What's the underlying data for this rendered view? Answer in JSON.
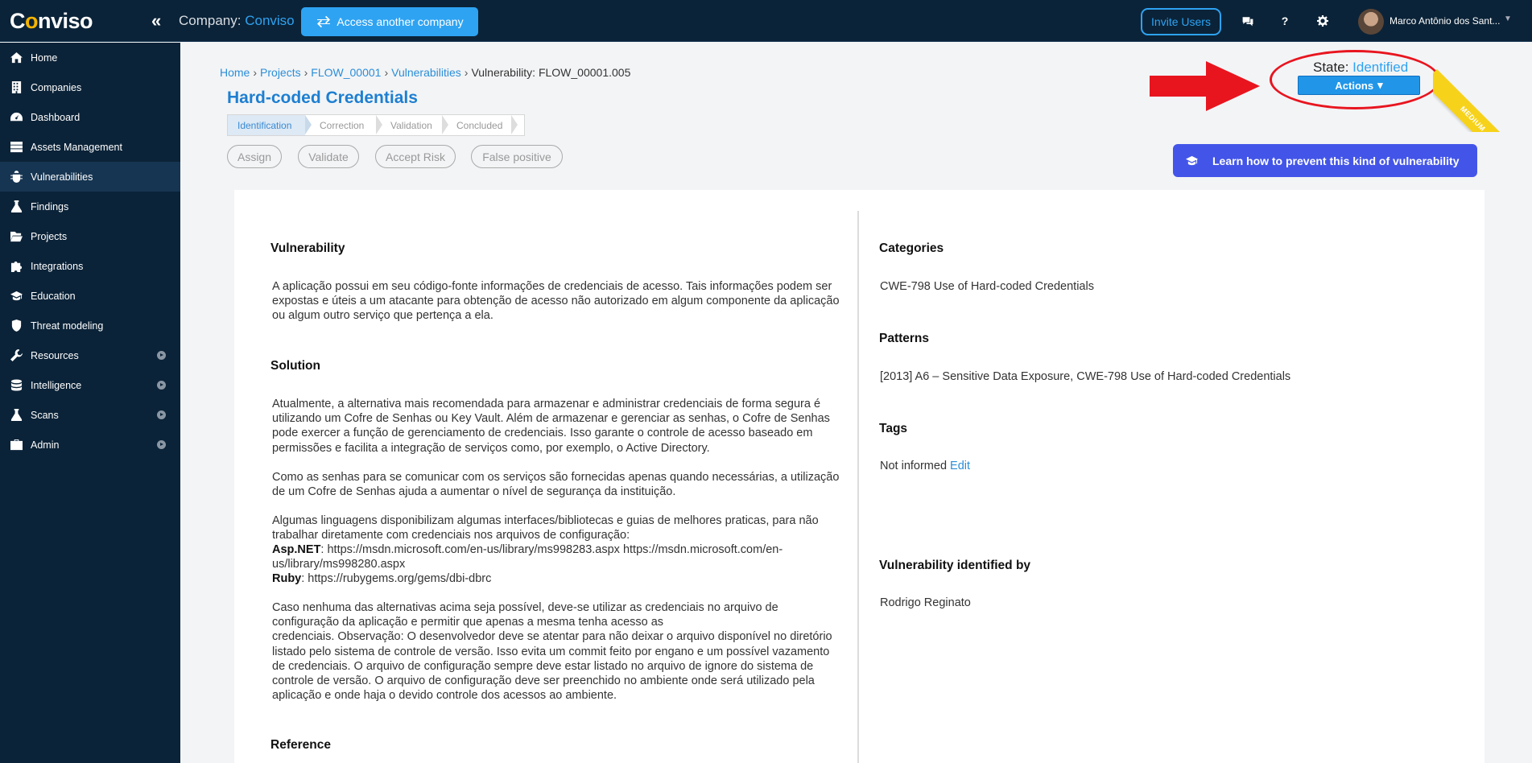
{
  "header": {
    "logo_text_c": "C",
    "logo_text_o": "o",
    "logo_text_rest": "nviso",
    "company_label": "Company:",
    "company_name": "Conviso",
    "access_button": "Access another company",
    "invite_button": "Invite Users",
    "user_name": "Marco Antônio dos Sant..."
  },
  "sidebar": {
    "items": [
      {
        "label": "Home",
        "icon": "home-icon"
      },
      {
        "label": "Companies",
        "icon": "building-icon"
      },
      {
        "label": "Dashboard",
        "icon": "dashboard-icon"
      },
      {
        "label": "Assets Management",
        "icon": "server-icon"
      },
      {
        "label": "Vulnerabilities",
        "icon": "bug-icon",
        "active": true
      },
      {
        "label": "Findings",
        "icon": "flask-icon"
      },
      {
        "label": "Projects",
        "icon": "folder-open-icon"
      },
      {
        "label": "Integrations",
        "icon": "puzzle-icon"
      },
      {
        "label": "Education",
        "icon": "graduation-cap-icon"
      },
      {
        "label": "Threat modeling",
        "icon": "shield-icon"
      },
      {
        "label": "Resources",
        "icon": "wrench-icon",
        "expandable": true
      },
      {
        "label": "Intelligence",
        "icon": "database-icon",
        "expandable": true
      },
      {
        "label": "Scans",
        "icon": "flask-icon",
        "expandable": true
      },
      {
        "label": "Admin",
        "icon": "briefcase-icon",
        "expandable": true
      }
    ]
  },
  "breadcrumb": {
    "home": "Home",
    "projects": "Projects",
    "project": "FLOW_00001",
    "vulnerabilities": "Vulnerabilities",
    "current": "Vulnerability: FLOW_00001.005"
  },
  "page_title": "Hard-coded Credentials",
  "steps": [
    "Identification",
    "Correction",
    "Validation",
    "Concluded"
  ],
  "actions_row": [
    "Assign",
    "Validate",
    "Accept Risk",
    "False positive"
  ],
  "state": {
    "label": "State:",
    "value": "Identified",
    "actions_button": "Actions",
    "severity_ribbon": "MEDIUM"
  },
  "learn_button": "Learn how to prevent this kind of vulnerability",
  "left": {
    "vulnerability_title": "Vulnerability",
    "vulnerability_text": "A aplicação possui em seu código-fonte informações de credenciais de acesso. Tais informações podem ser expostas e úteis a um atacante para obtenção de acesso não autorizado em algum componente da aplicação ou algum outro serviço que pertença a ela.",
    "solution_title": "Solution",
    "solution_p1": "Atualmente, a alternativa mais recomendada para armazenar e administrar credenciais de forma segura é utilizando um Cofre de Senhas ou Key Vault. Além de armazenar e gerenciar as senhas, o Cofre de Senhas pode exercer a função de gerenciamento de credenciais. Isso garante o controle de acesso baseado em permissões e facilita a integração de serviços como, por exemplo, o Active Directory.",
    "solution_p2": "Como as senhas para se comunicar com os serviços são fornecidas apenas quando necessárias, a utilização de um Cofre de Senhas ajuda a aumentar o nível de segurança da instituição.",
    "solution_p3": "Algumas linguagens disponibilizam algumas interfaces/bibliotecas e guias de melhores praticas, para não trabalhar diretamente com credenciais nos arquivos de configuração:",
    "aspnet_label": "Asp.NET",
    "aspnet_links": ": https://msdn.microsoft.com/en-us/library/ms998283.aspx https://msdn.microsoft.com/en-us/library/ms998280.aspx",
    "ruby_label": "Ruby",
    "ruby_links": ": https://rubygems.org/gems/dbi-dbrc",
    "solution_p4a": "Caso nenhuma das alternativas acima seja possível, deve-se utilizar as credenciais no arquivo de configuração da aplicação e permitir que apenas a mesma tenha acesso as",
    "solution_p4b": "credenciais. Observação: O desenvolvedor deve se atentar para não deixar o arquivo disponível no diretório listado pelo sistema de controle de versão. Isso evita um commit feito por engano e um possível vazamento de credenciais. O arquivo de configuração sempre deve estar listado no arquivo de ignore do sistema de controle de versão. O arquivo de configuração deve ser preenchido no ambiente onde será utilizado pela aplicação e onde haja o devido controle dos acessos ao ambiente.",
    "reference_title": "Reference"
  },
  "right": {
    "categories_title": "Categories",
    "categories_value": "CWE-798 Use of Hard-coded Credentials",
    "patterns_title": "Patterns",
    "patterns_value": "[2013] A6 – Sensitive Data Exposure, CWE-798 Use of Hard-coded Credentials",
    "tags_title": "Tags",
    "tags_value": "Not informed",
    "tags_edit": "Edit",
    "identified_by_title": "Vulnerability identified by",
    "identified_by_value": "Rodrigo Reginato"
  },
  "colors": {
    "topbar_bg": "#0b2338",
    "accent": "#2ea3f2",
    "title_blue": "#1d7fd1",
    "learn_button": "#4355e8",
    "annotation_red": "#e8151f",
    "ribbon_yellow": "#f7d21a"
  }
}
